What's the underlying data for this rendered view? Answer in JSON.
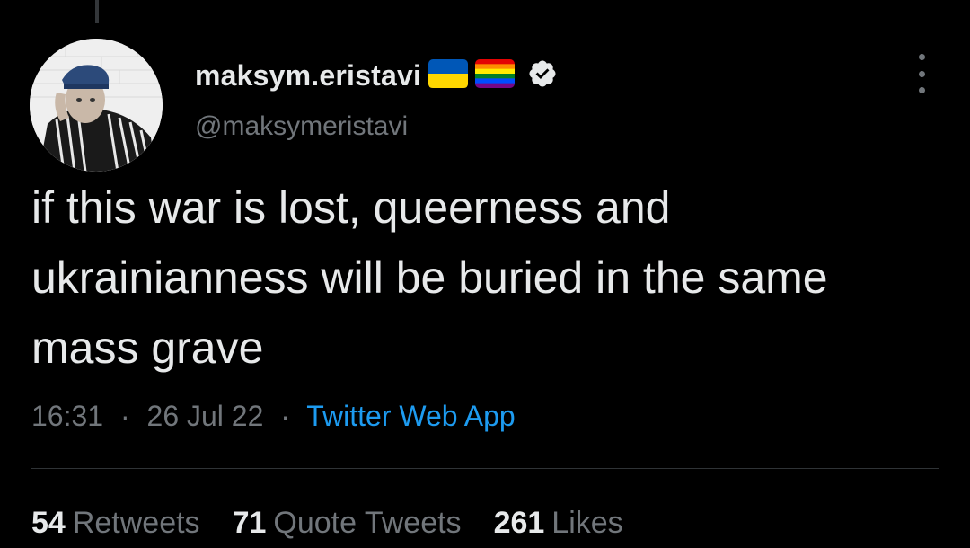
{
  "author": {
    "display_name": "maksym.eristavi",
    "handle": "@maksymeristavi",
    "badges": [
      "ukraine-flag-icon",
      "rainbow-flag-icon",
      "verified-badge-icon"
    ]
  },
  "tweet": {
    "text": "if this war is lost, queerness and ukrainianness will be buried in the same mass grave",
    "time": "16:31",
    "separator": "·",
    "date": "26 Jul 22",
    "source": "Twitter Web App"
  },
  "stats": {
    "retweets_count": "54",
    "retweets_label": "Retweets",
    "quote_tweets_count": "71",
    "quote_tweets_label": "Quote Tweets",
    "likes_count": "261",
    "likes_label": "Likes"
  },
  "colors": {
    "background": "#000000",
    "primary_text": "#e7e9ea",
    "secondary_text": "#71767b",
    "link": "#1d9bf0",
    "divider": "#2f3336"
  }
}
